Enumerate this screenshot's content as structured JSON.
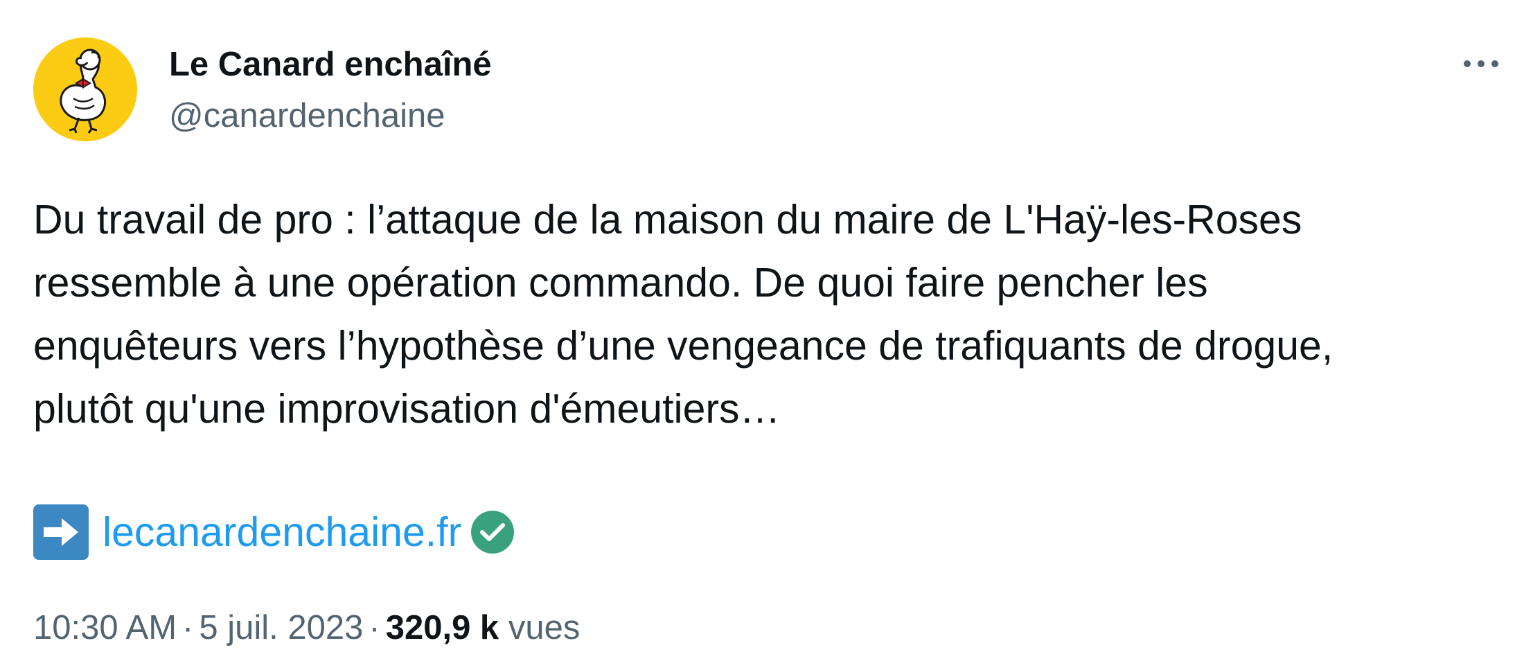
{
  "author": {
    "display_name": "Le Canard enchaîné",
    "handle": "@canardenchaine",
    "avatar_icon": "canard-duck-logo",
    "avatar_color": "#fccc14"
  },
  "tweet": {
    "text": "Du travail de pro : l’attaque de la maison du maire de L'Haÿ-les-Roses\nressemble à une opération commando. De quoi faire pencher les\nenquêteurs vers l’hypothèse d’une vengeance de trafiquants de drogue,\nplutôt qu'une improvisation d'émeutiers…",
    "link_prefix_icon": "right-arrow-emoji-icon",
    "link_text": "lecanardenchaine.fr",
    "link_suffix_icon": "check-mark-emoji-icon"
  },
  "meta": {
    "time": "10:30 AM",
    "separator": "·",
    "date": "5 juil. 2023",
    "views_count": "320,9 k",
    "views_label": "vues"
  },
  "menu": {
    "more_icon": "more-options-icon"
  },
  "colors": {
    "text_primary": "#0f1419",
    "text_secondary": "#536471",
    "link": "#1d9bf0",
    "arrow_emoji_bg": "#3b88c3",
    "check_emoji_bg": "#3aa17e"
  }
}
